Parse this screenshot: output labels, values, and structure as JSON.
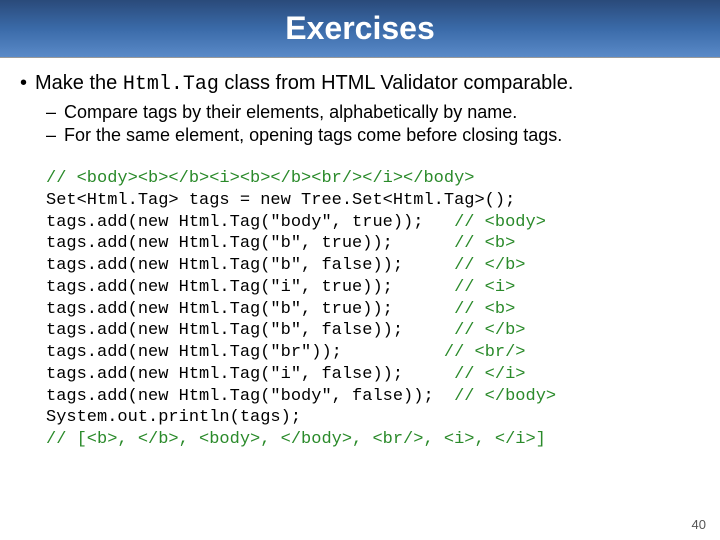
{
  "title": "Exercises",
  "bullet_main": {
    "prefix": "Make the ",
    "code": "Html.Tag",
    "suffix": " class from HTML Validator comparable."
  },
  "sub": [
    "Compare tags by their elements, alphabetically by name.",
    "For the same element, opening tags come before closing tags."
  ],
  "code": {
    "c1": "// <body><b></b><i><b></b><br/></i></body>",
    "l1": "Set<Html.Tag> tags = new Tree.Set<Html.Tag>();",
    "rows": [
      {
        "a": "tags.add(new Html.Tag(\"body\", true));",
        "pad": "   ",
        "c": "// <body>"
      },
      {
        "a": "tags.add(new Html.Tag(\"b\", true));",
        "pad": "      ",
        "c": "// <b>"
      },
      {
        "a": "tags.add(new Html.Tag(\"b\", false));",
        "pad": "     ",
        "c": "// </b>"
      },
      {
        "a": "tags.add(new Html.Tag(\"i\", true));",
        "pad": "      ",
        "c": "// <i>"
      },
      {
        "a": "tags.add(new Html.Tag(\"b\", true));",
        "pad": "      ",
        "c": "// <b>"
      },
      {
        "a": "tags.add(new Html.Tag(\"b\", false));",
        "pad": "     ",
        "c": "// </b>"
      },
      {
        "a": "tags.add(new Html.Tag(\"br\"));",
        "pad": "          ",
        "c": "// <br/>"
      },
      {
        "a": "tags.add(new Html.Tag(\"i\", false));",
        "pad": "     ",
        "c": "// </i>"
      },
      {
        "a": "tags.add(new Html.Tag(\"body\", false));",
        "pad": "  ",
        "c": "// </body>"
      }
    ],
    "l2": "System.out.println(tags);",
    "c2": "// [<b>, </b>, <body>, </body>, <br/>, <i>, </i>]"
  },
  "page_number": "40"
}
